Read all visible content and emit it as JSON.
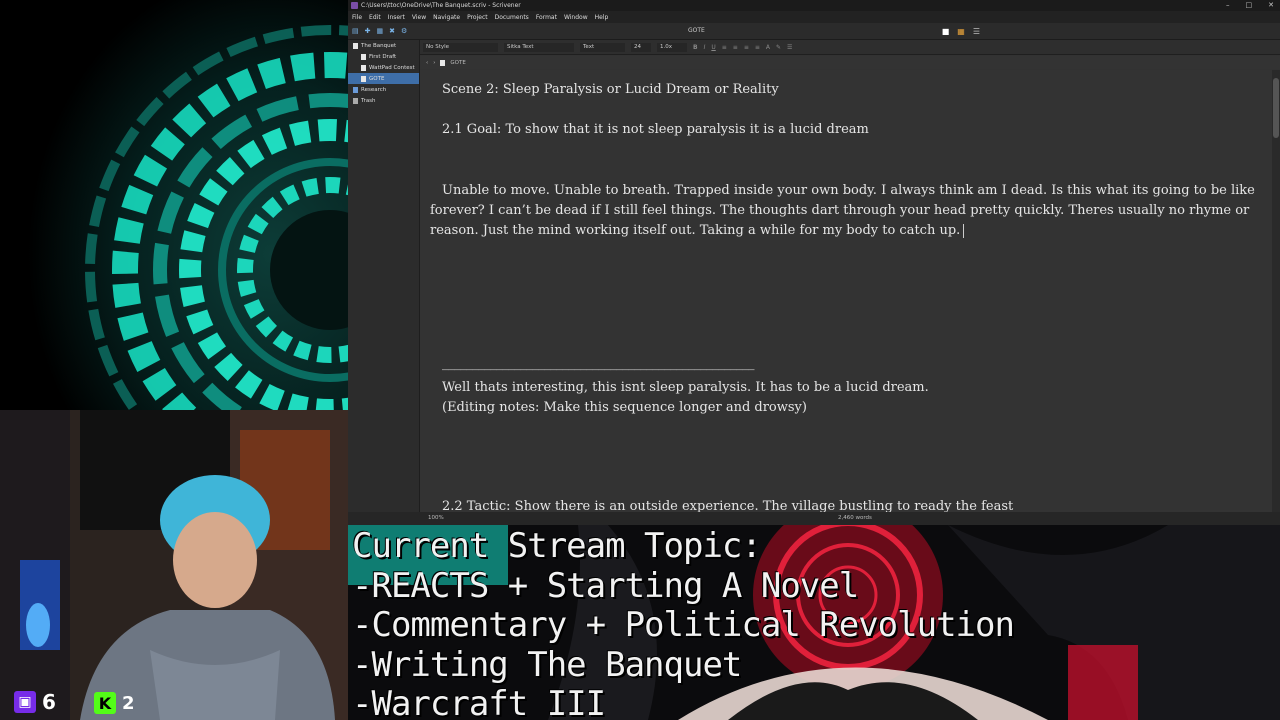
{
  "window": {
    "title": "C:\\Users\\ttoc\\OneDrive\\The Banquet.scriv - Scrivener",
    "minimize": "–",
    "maximize": "□",
    "close": "✕"
  },
  "menu": [
    "File",
    "Edit",
    "Insert",
    "View",
    "Navigate",
    "Project",
    "Documents",
    "Format",
    "Window",
    "Help"
  ],
  "toolbar": {
    "document_title": "GOTE"
  },
  "binder": {
    "items": [
      {
        "label": "The Banquet",
        "level": 0
      },
      {
        "label": "First Draft",
        "level": 1
      },
      {
        "label": "WattPad Contest",
        "level": 1
      },
      {
        "label": "GOTE",
        "level": 1,
        "selected": true
      },
      {
        "label": "Research",
        "level": 0
      },
      {
        "label": "Trash",
        "level": 0
      }
    ]
  },
  "format": {
    "style": "No Style",
    "font": "Sitka Text",
    "face": "Text",
    "size": "24",
    "spacing": "1.0x",
    "bold": "B",
    "italic": "I",
    "underline": "U"
  },
  "header": {
    "doc_name": "GOTE"
  },
  "editor": {
    "scene_title": "Scene 2: Sleep Paralysis or Lucid Dream or Reality",
    "goal": "2.1 Goal: To show that it is not sleep paralysis it is a lucid dream",
    "paragraph": "Unable to move. Unable to breath. Trapped inside your own body. I always think am I dead. Is this what its going to be like forever? I can’t be dead if I still feel things. The thoughts dart through your head pretty quickly. Theres usually no rhyme or reason. Just the mind working itself out. Taking a while for my body to catch up.",
    "divider": "____________________________________________________",
    "line1": "Well thats interesting, this isnt sleep paralysis. It has to be a lucid dream.",
    "line2": "(Editing notes: Make this sequence longer and drowsy)",
    "tactic": "2.2 Tactic: Show there is an outside experience. The village bustling to ready the feast"
  },
  "footer": {
    "zoom": "100%",
    "word_count": "2,460 words"
  },
  "stream": {
    "twitch_viewers": "6",
    "kick_viewers": "2",
    "topic_lines": [
      "Current Stream Topic:",
      "-REACTS + Starting A Novel",
      "-Commentary + Political Revolution",
      "-Writing The Banquet",
      "-Warcraft III"
    ]
  },
  "colors": {
    "editor_bg": "#333333",
    "selection": "#3e6ea8",
    "visualizer_teal": "#19e6c8",
    "topic_red": "#c8102e",
    "twitch": "#772ce8",
    "kick": "#53fc18"
  }
}
